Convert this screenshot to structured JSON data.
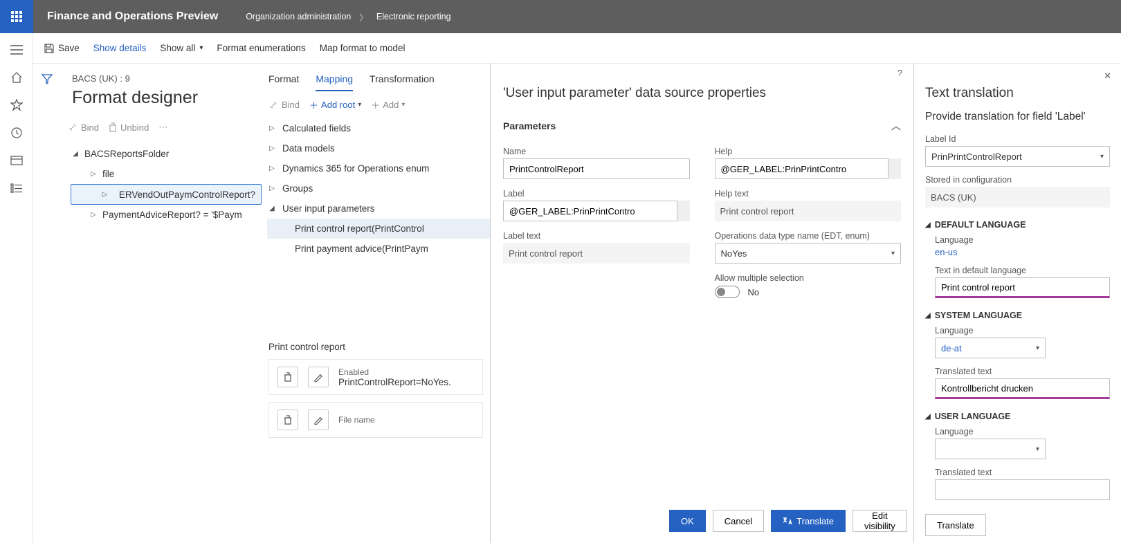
{
  "header": {
    "app_title": "Finance and Operations Preview",
    "breadcrumb": [
      "Organization administration",
      "Electronic reporting"
    ]
  },
  "cmdbar": {
    "save": "Save",
    "show_details": "Show details",
    "show_all": "Show all",
    "format_enum": "Format enumerations",
    "map_format": "Map format to model"
  },
  "title": {
    "sup": "BACS (UK) : 9",
    "main": "Format designer"
  },
  "mini": {
    "bind": "Bind",
    "unbind": "Unbind"
  },
  "tree": {
    "n0": "BACSReportsFolder",
    "n1": "file",
    "n2": "ERVendOutPaymControlReport?",
    "n3": "PaymentAdviceReport? = '$Paym"
  },
  "tabs": {
    "t1": "Format",
    "t2": "Mapping",
    "t3": "Transformation"
  },
  "tool": {
    "bind": "Bind",
    "add_root": "Add root",
    "add": "Add"
  },
  "ds": {
    "n0": "Calculated fields",
    "n1": "Data models",
    "n2": "Dynamics 365 for Operations enum",
    "n3": "Groups",
    "n4": "User input parameters",
    "n5": "Print control report(PrintControl",
    "n6": "Print payment advice(PrintPaym"
  },
  "details": {
    "name": "Print control report",
    "enabled_lbl": "Enabled",
    "enabled_val": "PrintControlReport=NoYes.",
    "file_lbl": "File name"
  },
  "panel": {
    "title": "'User input parameter' data source properties",
    "section": "Parameters",
    "name": {
      "lbl": "Name",
      "val": "PrintControlReport"
    },
    "label": {
      "lbl": "Label",
      "val": "@GER_LABEL:PrinPrintContro"
    },
    "labeltext": {
      "lbl": "Label text",
      "val": "Print control report"
    },
    "help": {
      "lbl": "Help",
      "val": "@GER_LABEL:PrinPrintContro"
    },
    "helptext": {
      "lbl": "Help text",
      "val": "Print control report"
    },
    "edt": {
      "lbl": "Operations data type name (EDT, enum)",
      "val": "NoYes"
    },
    "multi": {
      "lbl": "Allow multiple selection",
      "val": "No"
    },
    "btns": {
      "ok": "OK",
      "cancel": "Cancel",
      "translate": "Translate",
      "edit_vis": "Edit visibility"
    }
  },
  "trans": {
    "title": "Text translation",
    "subtitle": "Provide translation for field 'Label'",
    "labelid": {
      "lbl": "Label Id",
      "val": "PrinPrintControlReport"
    },
    "stored": {
      "lbl": "Stored in configuration",
      "val": "BACS (UK)"
    },
    "grp1": "DEFAULT LANGUAGE",
    "g1_lang": {
      "lbl": "Language",
      "val": "en-us"
    },
    "g1_text": {
      "lbl": "Text in default language",
      "val": "Print control report"
    },
    "grp2": "SYSTEM LANGUAGE",
    "g2_lang": {
      "lbl": "Language",
      "val": "de-at"
    },
    "g2_text": {
      "lbl": "Translated text",
      "val": "Kontrollbericht drucken"
    },
    "grp3": "USER LANGUAGE",
    "g3_lang": {
      "lbl": "Language",
      "val": ""
    },
    "g3_text": {
      "lbl": "Translated text",
      "val": ""
    },
    "btn": "Translate"
  }
}
